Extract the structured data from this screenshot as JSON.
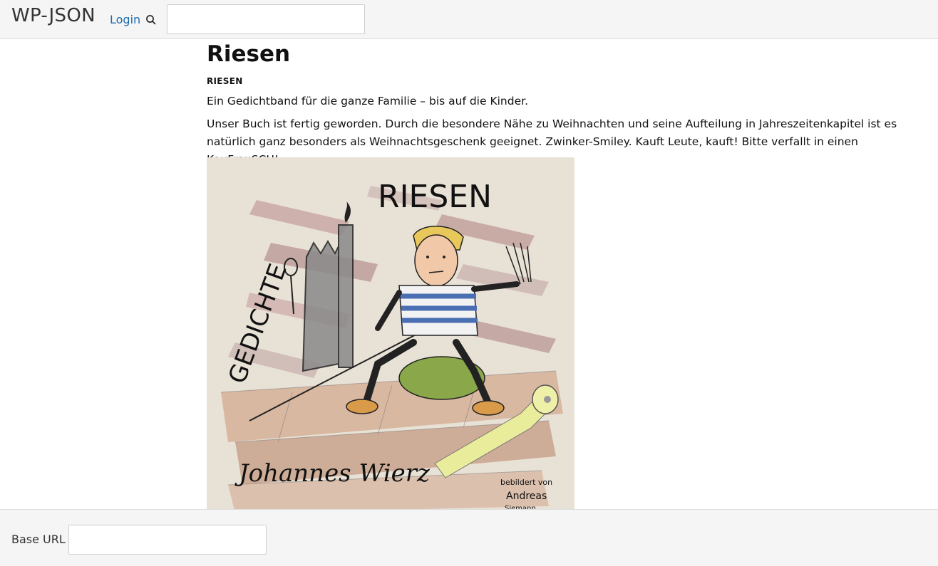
{
  "header": {
    "brand": "WP-JSON",
    "login_label": "Login",
    "search": {
      "value": "",
      "placeholder": ""
    },
    "search_icon": "search-icon"
  },
  "article": {
    "title": "Riesen",
    "subtitle": "RIESEN",
    "paragraphs": [
      "Ein Gedichtband für die ganze Familie – bis auf die Kinder.",
      "Unser Buch ist fertig geworden. Durch die besondere Nähe zu Weihnachten und seine Aufteilung in Jahreszeitenkapitel ist es natürlich ganz besonders als Weihnachtsgeschenk geeignet. Zwinker-Smiley. Kauft Leute, kauft! Bitte verfallt in einen KauFrauSCH!"
    ],
    "cover": {
      "title": "RIESEN",
      "subtitle": "GEDICHTE",
      "author": "Johannes Wierz",
      "credit_line1": "bebildert von",
      "credit_line2": "Andreas",
      "credit_line3": "Siemann"
    }
  },
  "footer": {
    "base_url_label": "Base URL",
    "base_url": {
      "value": "",
      "placeholder": ""
    }
  },
  "colors": {
    "link": "#1e6bb0",
    "bar_background": "#f5f5f5",
    "border": "#dcdcdc"
  }
}
